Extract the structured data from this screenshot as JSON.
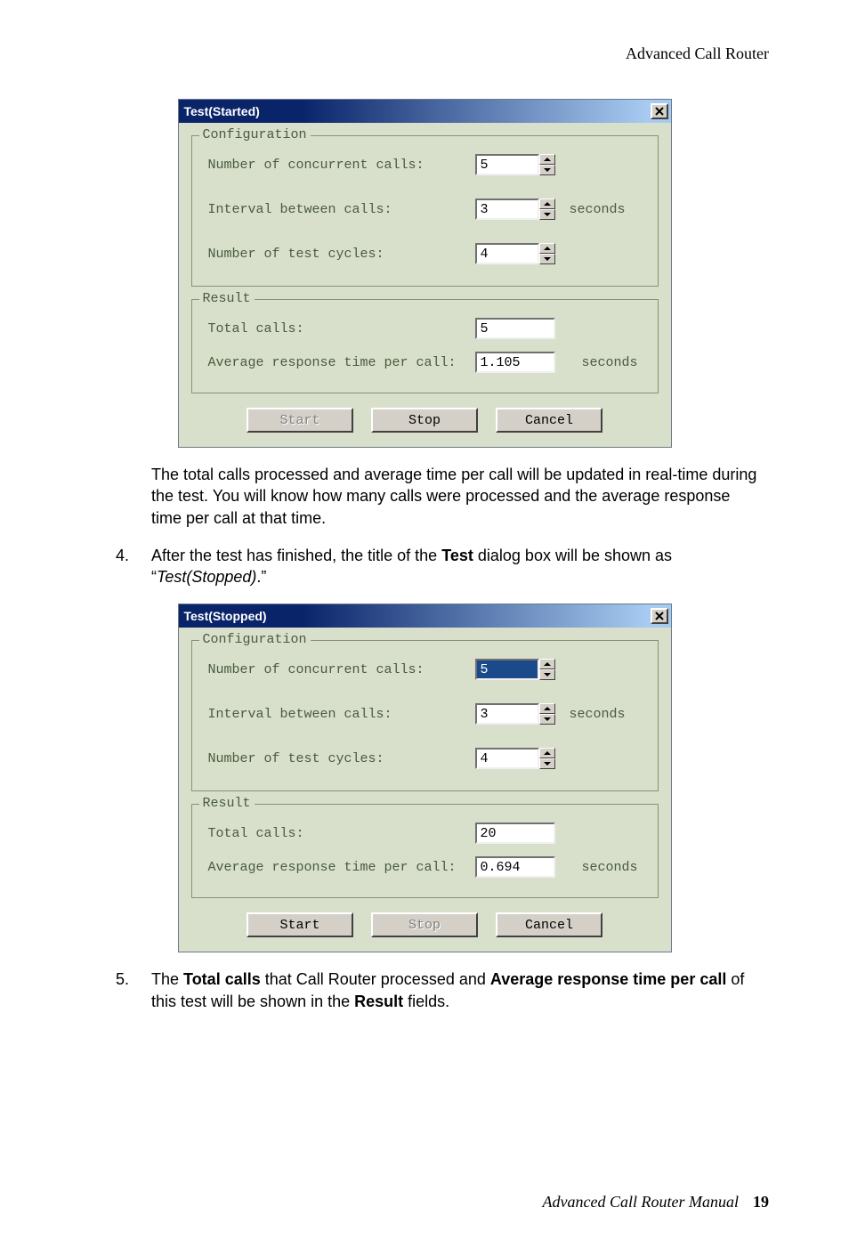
{
  "header": "Advanced Call Router",
  "dialog_started": {
    "title": "Test(Started)",
    "config_legend": "Configuration",
    "labels": {
      "concurrent": "Number of concurrent calls:",
      "interval": "Interval between calls:",
      "cycles": "Number of test cycles:"
    },
    "values": {
      "concurrent": "5",
      "interval": "3",
      "cycles": "4"
    },
    "unit_seconds": "seconds",
    "result_legend": "Result",
    "result_labels": {
      "total": "Total calls:",
      "avg": "Average response time per call:"
    },
    "result_values": {
      "total": "5",
      "avg": "1.105"
    },
    "buttons": {
      "start": "Start",
      "stop": "Stop",
      "cancel": "Cancel"
    }
  },
  "dialog_stopped": {
    "title": "Test(Stopped)",
    "config_legend": "Configuration",
    "labels": {
      "concurrent": "Number of concurrent calls:",
      "interval": "Interval between calls:",
      "cycles": "Number of test cycles:"
    },
    "values": {
      "concurrent": "5",
      "interval": "3",
      "cycles": "4"
    },
    "unit_seconds": "seconds",
    "result_legend": "Result",
    "result_labels": {
      "total": "Total calls:",
      "avg": "Average response time per call:"
    },
    "result_values": {
      "total": "20",
      "avg": "0.694"
    },
    "buttons": {
      "start": "Start",
      "stop": "Stop",
      "cancel": "Cancel"
    }
  },
  "para1": "The total calls processed and average time per call will be updated in real-time during the test. You will know how many calls were processed and the average response time per call at that time.",
  "item4_prefix": "After the test has finished, the title of the ",
  "item4_bold": "Test",
  "item4_mid": " dialog box will be shown as “",
  "item4_italic": "Test(Stopped)",
  "item4_suffix": ".”",
  "item5_prefix": "The ",
  "item5_b1": "Total calls",
  "item5_mid1": " that Call Router processed and ",
  "item5_b2": "Average response time per call",
  "item5_mid2": " of this test will be shown in the ",
  "item5_b3": "Result",
  "item5_suffix": " fields.",
  "list_nums": {
    "n4": "4.",
    "n5": "5."
  },
  "footer_text": "Advanced Call Router Manual",
  "footer_page": "19"
}
